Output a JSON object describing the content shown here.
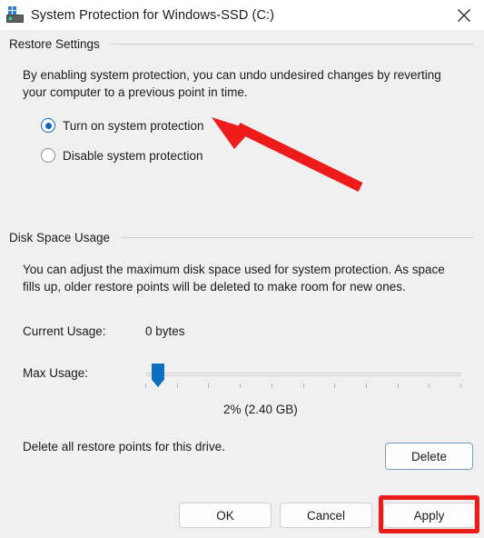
{
  "window": {
    "title": "System Protection for Windows-SSD (C:)",
    "icon": "system-drive-icon",
    "close_icon": "close-icon"
  },
  "restore_settings": {
    "header": "Restore Settings",
    "description": "By enabling system protection, you can undo undesired changes by reverting your computer to a previous point in time.",
    "options": [
      {
        "label": "Turn on system protection",
        "selected": true
      },
      {
        "label": "Disable system protection",
        "selected": false
      }
    ]
  },
  "disk_space_usage": {
    "header": "Disk Space Usage",
    "description": "You can adjust the maximum disk space used for system protection. As space fills up, older restore points will be deleted to make room for new ones.",
    "current_usage_label": "Current Usage:",
    "current_usage_value": "0 bytes",
    "max_usage_label": "Max Usage:",
    "max_usage_percent": 2,
    "max_usage_text": "2% (2.40 GB)",
    "slider_ticks": 11,
    "delete_text": "Delete all restore points for this drive.",
    "delete_button": "Delete"
  },
  "footer": {
    "ok": "OK",
    "cancel": "Cancel",
    "apply": "Apply"
  },
  "annotations": {
    "arrow_color": "#ee1b1b",
    "highlight_color": "#ee1b1b",
    "arrow_target": "Turn on system protection",
    "highlight_target": "Apply"
  },
  "colors": {
    "accent": "#0a65c2",
    "slider_thumb": "#0d6ebf",
    "dialog_background": "#f0f0f0",
    "titlebar_background": "#ffffff"
  }
}
